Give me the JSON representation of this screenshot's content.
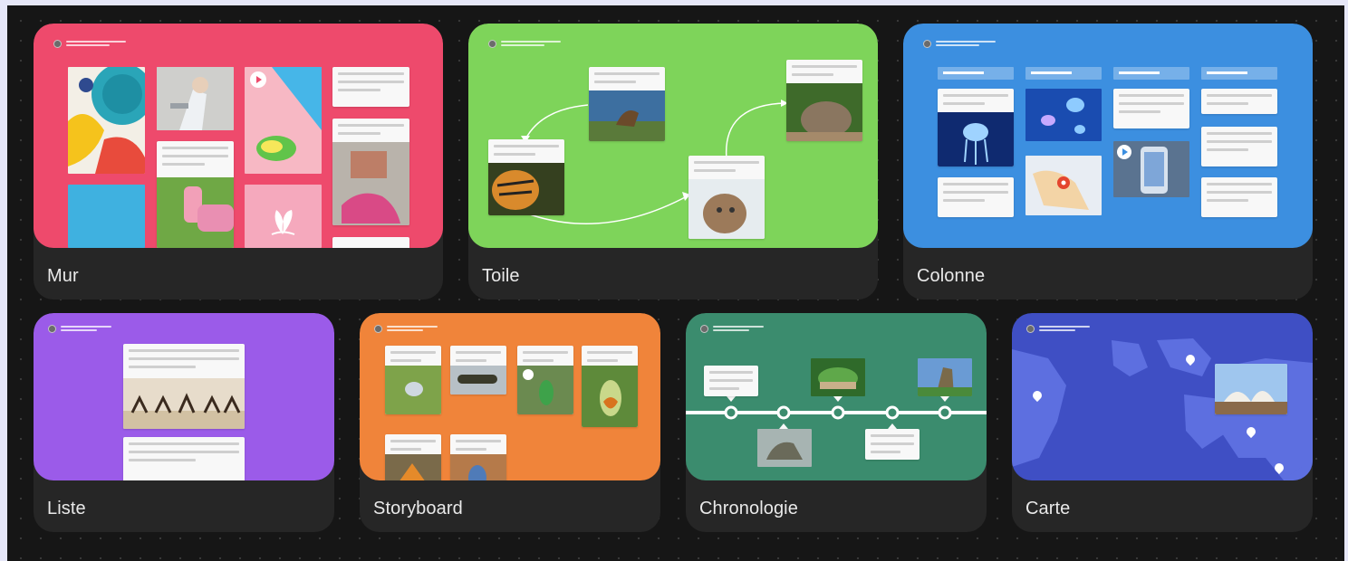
{
  "templates": [
    {
      "label": "Mur",
      "color": "#ee4a6c"
    },
    {
      "label": "Toile",
      "color": "#7ed45a"
    },
    {
      "label": "Colonne",
      "color": "#3c8fe0"
    },
    {
      "label": "Liste",
      "color": "#9b5be9"
    },
    {
      "label": "Storyboard",
      "color": "#f0843a"
    },
    {
      "label": "Chronologie",
      "color": "#3b8c6e"
    },
    {
      "label": "Carte",
      "color": "#3f4fc4"
    }
  ]
}
